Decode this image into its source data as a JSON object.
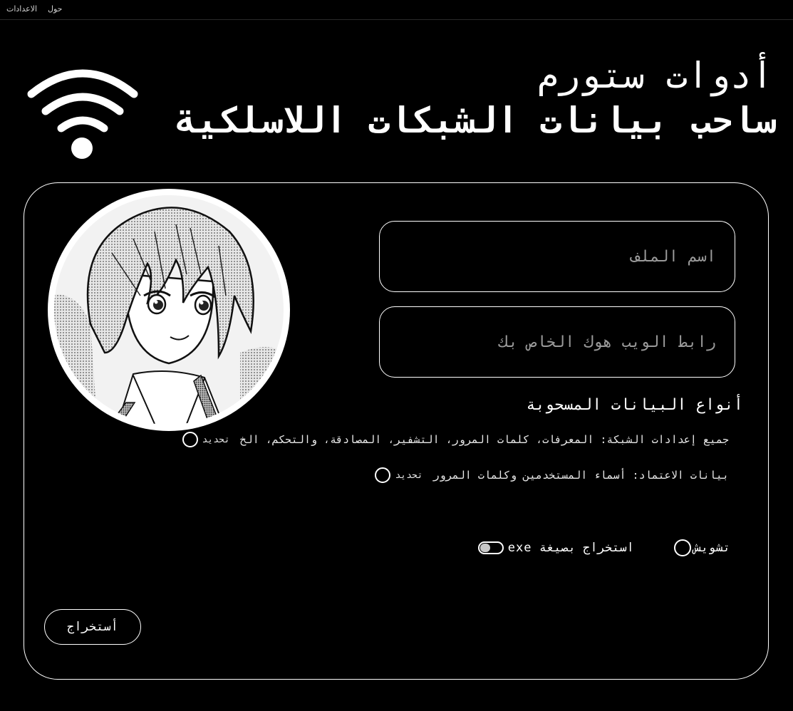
{
  "menu": {
    "settings_label": "الاعدادات",
    "about_label": "حول"
  },
  "header": {
    "subtitle": "أدوات ستورم",
    "title": "ساحب بيانات الشبكات اللاسلكية",
    "logo_icon": "wifi-icon"
  },
  "form": {
    "filename_placeholder": "اسم الملف",
    "webhook_placeholder": "رابط الويب هوك الخاص بك",
    "data_types_title": "أنواع البيانات المسحوبة",
    "options": [
      {
        "text": "جميع إعدادات الشبكة: المعرفات، كلمات المرور، التشفير، المصادقة، والتحكم، الخ",
        "select_label": "تحديد"
      },
      {
        "text": "بيانات الاعتماد: أسماء المستخدمين وكلمات المرور",
        "select_label": "تحديد"
      }
    ],
    "obfuscate_label": "تشويش",
    "exe_label": "استخراج بصيغة exe",
    "extract_button": "أستخراج"
  },
  "colors": {
    "background": "#000000",
    "foreground": "#ffffff",
    "placeholder": "#9a9a9a"
  }
}
